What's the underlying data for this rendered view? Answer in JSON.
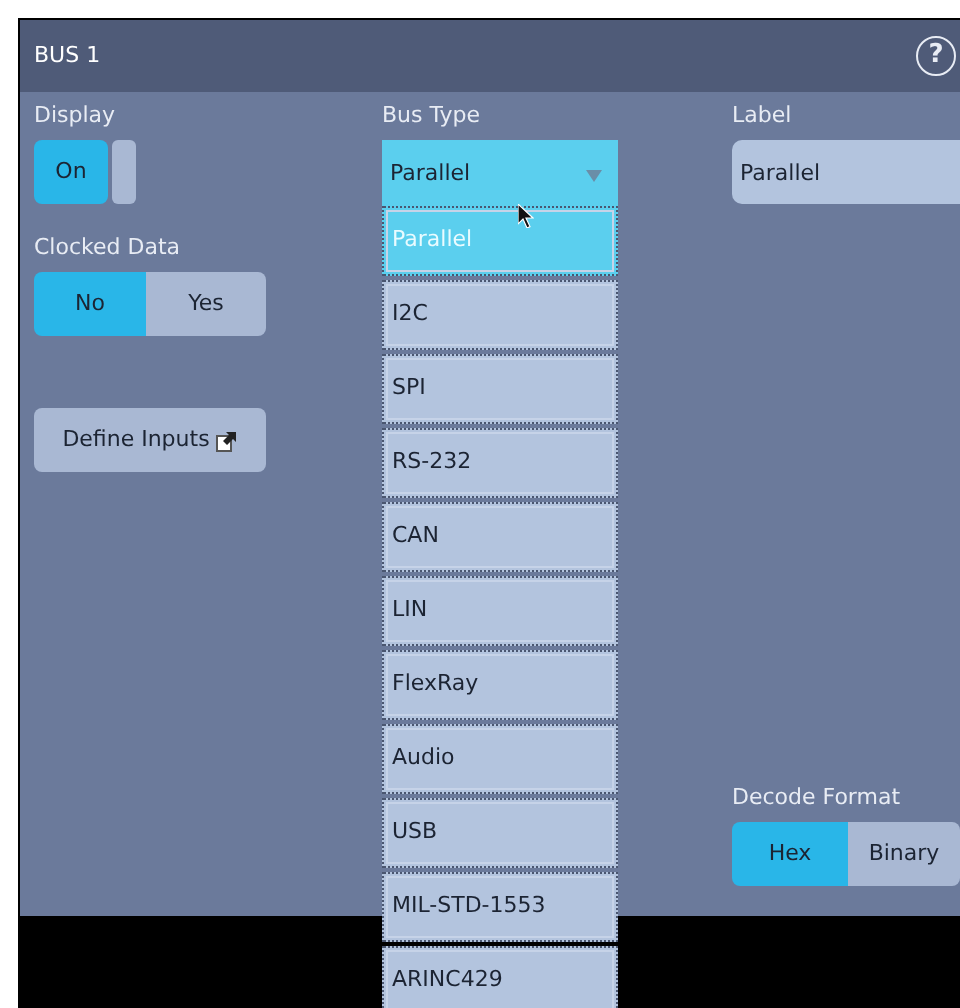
{
  "window": {
    "title": "BUS 1",
    "help": "?"
  },
  "display": {
    "label": "Display",
    "state_text": "On",
    "on": true
  },
  "clocked_data": {
    "label": "Clocked Data",
    "options": [
      {
        "label": "No",
        "selected": true
      },
      {
        "label": "Yes",
        "selected": false
      }
    ]
  },
  "define_inputs": {
    "label": "Define Inputs"
  },
  "bus_type": {
    "label": "Bus Type",
    "value": "Parallel",
    "expanded": true,
    "options": [
      {
        "label": "Parallel",
        "selected": true
      },
      {
        "label": "I2C",
        "selected": false
      },
      {
        "label": "SPI",
        "selected": false
      },
      {
        "label": "RS-232",
        "selected": false
      },
      {
        "label": "CAN",
        "selected": false
      },
      {
        "label": "LIN",
        "selected": false
      },
      {
        "label": "FlexRay",
        "selected": false
      },
      {
        "label": "Audio",
        "selected": false
      },
      {
        "label": "USB",
        "selected": false
      },
      {
        "label": "MIL-STD-1553",
        "selected": false
      },
      {
        "label": "ARINC429",
        "selected": false
      }
    ]
  },
  "label_field": {
    "label": "Label",
    "value": "Parallel"
  },
  "decode_format": {
    "label": "Decode Format",
    "options": [
      {
        "label": "Hex",
        "selected": true
      },
      {
        "label": "Binary",
        "selected": false
      }
    ]
  }
}
